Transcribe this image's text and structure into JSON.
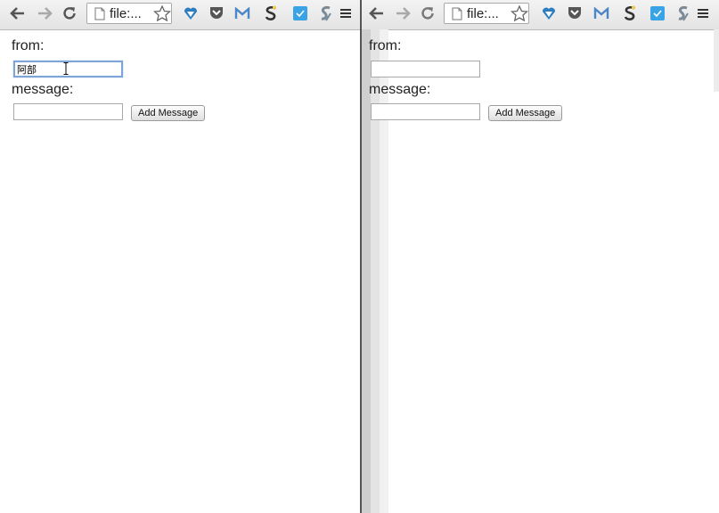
{
  "browser": {
    "url": "file:..."
  },
  "form": {
    "from_label": "from:",
    "message_label": "message:",
    "button_label": "Add Message"
  },
  "left": {
    "from_value": "阿部",
    "message_value": ""
  },
  "right": {
    "from_value": "",
    "message_value": ""
  },
  "icons": {
    "toolbar": [
      "back-arrow-icon",
      "forward-arrow-icon",
      "reload-icon",
      "page-icon",
      "bookmark-star-icon",
      "extension-heart-icon",
      "pocket-icon",
      "gmail-icon",
      "extension-s-icon",
      "checkbox-extension-icon",
      "extension-swirl-icon",
      "menu-icon"
    ]
  },
  "colors": {
    "focus_ring": "#7fa4d8",
    "pocket": "#e04a5c",
    "gmail": "#4a86c8",
    "check_ext": "#39a3e6",
    "heart": "#2d7ec0"
  }
}
